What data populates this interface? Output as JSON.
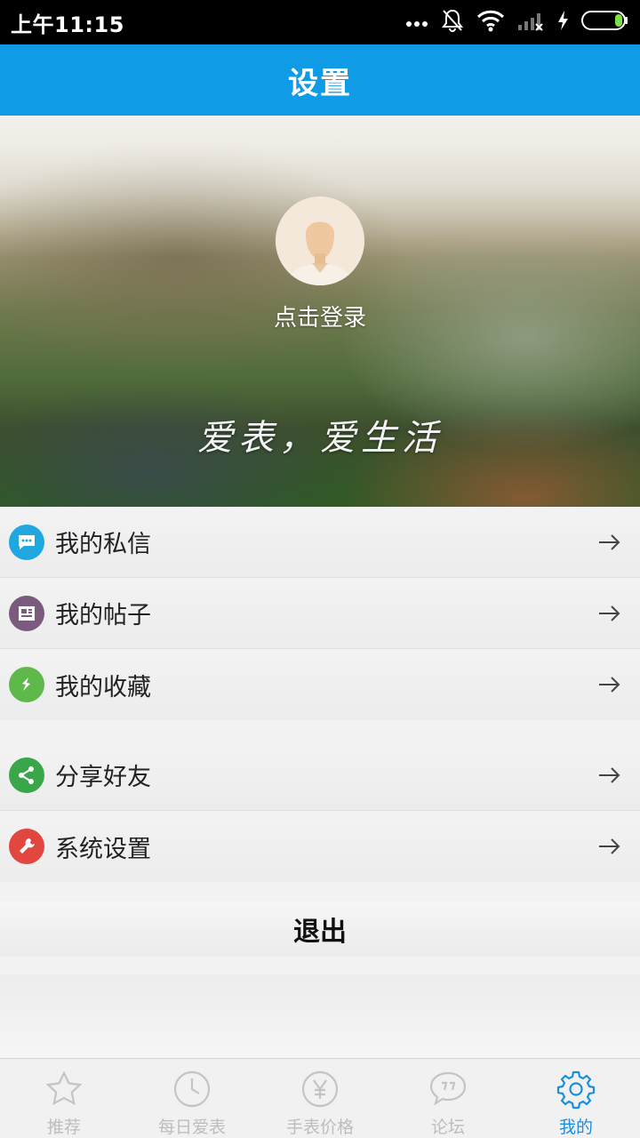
{
  "status_bar": {
    "time": "上午11:15",
    "icons": [
      "more-dots-icon",
      "notification-off-icon",
      "wifi-icon",
      "signal-icon",
      "charging-icon",
      "battery-icon"
    ]
  },
  "header": {
    "title": "设置"
  },
  "hero": {
    "login_label": "点击登录",
    "slogan": "爱表，爱生活"
  },
  "menu": {
    "group1": [
      {
        "label": "我的私信",
        "icon": "message-icon",
        "color": "#21a7e0"
      },
      {
        "label": "我的帖子",
        "icon": "posts-icon",
        "color": "#7a5b7e"
      },
      {
        "label": "我的收藏",
        "icon": "favorites-icon",
        "color": "#5fb84a"
      }
    ],
    "group2": [
      {
        "label": "分享好友",
        "icon": "share-icon",
        "color": "#3aa64a"
      },
      {
        "label": "系统设置",
        "icon": "wrench-icon",
        "color": "#e2473f"
      }
    ]
  },
  "logout_label": "退出",
  "tabs": [
    {
      "label": "推荐",
      "icon": "star-icon",
      "active": false
    },
    {
      "label": "每日爱表",
      "icon": "clock-icon",
      "active": false
    },
    {
      "label": "手表价格",
      "icon": "yen-icon",
      "active": false
    },
    {
      "label": "论坛",
      "icon": "forum-icon",
      "active": false
    },
    {
      "label": "我的",
      "icon": "gear-icon",
      "active": true
    }
  ],
  "colors": {
    "accent": "#0f9be6",
    "active_tab": "#1a8fe0",
    "inactive_tab": "#bdbdbd"
  }
}
